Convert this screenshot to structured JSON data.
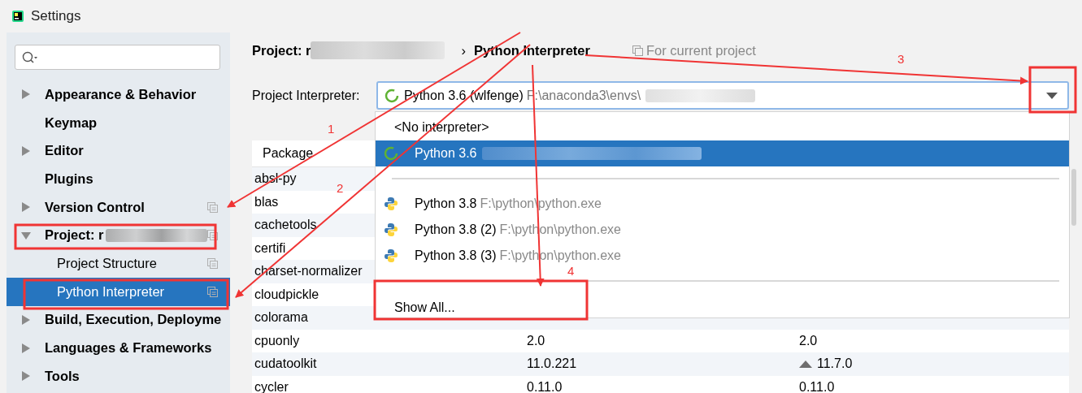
{
  "window": {
    "title": "Settings"
  },
  "sidebar": {
    "items": [
      {
        "label": "Appearance & Behavior",
        "kind": "group",
        "expanded": false,
        "selected": false,
        "project_level": false
      },
      {
        "label": "Keymap",
        "kind": "leaf",
        "selected": false,
        "project_level": false
      },
      {
        "label": "Editor",
        "kind": "group",
        "expanded": false,
        "selected": false,
        "project_level": false
      },
      {
        "label": "Plugins",
        "kind": "leaf",
        "selected": false,
        "project_level": false
      },
      {
        "label": "Version Control",
        "kind": "group",
        "expanded": false,
        "selected": false,
        "project_level": true
      },
      {
        "label": "Project: r",
        "kind": "group",
        "expanded": true,
        "redacted": true,
        "selected": false,
        "project_level": true,
        "children": [
          {
            "label": "Project Structure",
            "selected": false,
            "project_level": true
          },
          {
            "label": "Python Interpreter",
            "selected": true,
            "project_level": true
          }
        ]
      },
      {
        "label": "Build, Execution, Deployme",
        "kind": "group",
        "expanded": false,
        "selected": false,
        "project_level": false
      },
      {
        "label": "Languages & Frameworks",
        "kind": "group",
        "expanded": false,
        "selected": false,
        "project_level": false
      },
      {
        "label": "Tools",
        "kind": "group",
        "expanded": false,
        "selected": false,
        "project_level": false
      }
    ]
  },
  "breadcrumb": {
    "project": "Project: r",
    "separator": "›",
    "page": "Python Interpreter",
    "scope": "For current project"
  },
  "interpreter": {
    "label": "Project Interpreter:",
    "name": "Python 3.6 (wlfenge)",
    "path": "F:\\anaconda3\\envs\\"
  },
  "table": {
    "columns": [
      "Package"
    ],
    "rows": [
      {
        "package": "absl-py"
      },
      {
        "package": "blas"
      },
      {
        "package": "cachetools"
      },
      {
        "package": "certifi"
      },
      {
        "package": "charset-normalizer"
      },
      {
        "package": "cloudpickle"
      },
      {
        "package": "colorama"
      },
      {
        "package": "cpuonly",
        "version": "2.0",
        "latest": "2.0",
        "upgrade": false
      },
      {
        "package": "cudatoolkit",
        "version": "11.0.221",
        "latest": "11.7.0",
        "upgrade": true
      },
      {
        "package": "cycler",
        "version": "0.11.0",
        "latest": "0.11.0",
        "upgrade": false
      }
    ]
  },
  "dropdown": {
    "items": [
      {
        "kind": "none",
        "name": "<No interpreter>",
        "selected": false
      },
      {
        "kind": "conda",
        "name": "Python 3.6",
        "redacted": true,
        "selected": true
      },
      {
        "kind": "separator"
      },
      {
        "kind": "python",
        "name": "Python 3.8",
        "path": "F:\\python\\python.exe",
        "selected": false
      },
      {
        "kind": "python",
        "name": "Python 3.8 (2)",
        "path": "F:\\python\\python.exe",
        "selected": false
      },
      {
        "kind": "python",
        "name": "Python 3.8 (3)",
        "path": "F:\\python\\python.exe",
        "selected": false
      },
      {
        "kind": "separator"
      },
      {
        "kind": "action",
        "name": "Show All...",
        "selected": false
      }
    ]
  },
  "annotations": [
    {
      "number": "1"
    },
    {
      "number": "2"
    },
    {
      "number": "3"
    },
    {
      "number": "4"
    }
  ]
}
